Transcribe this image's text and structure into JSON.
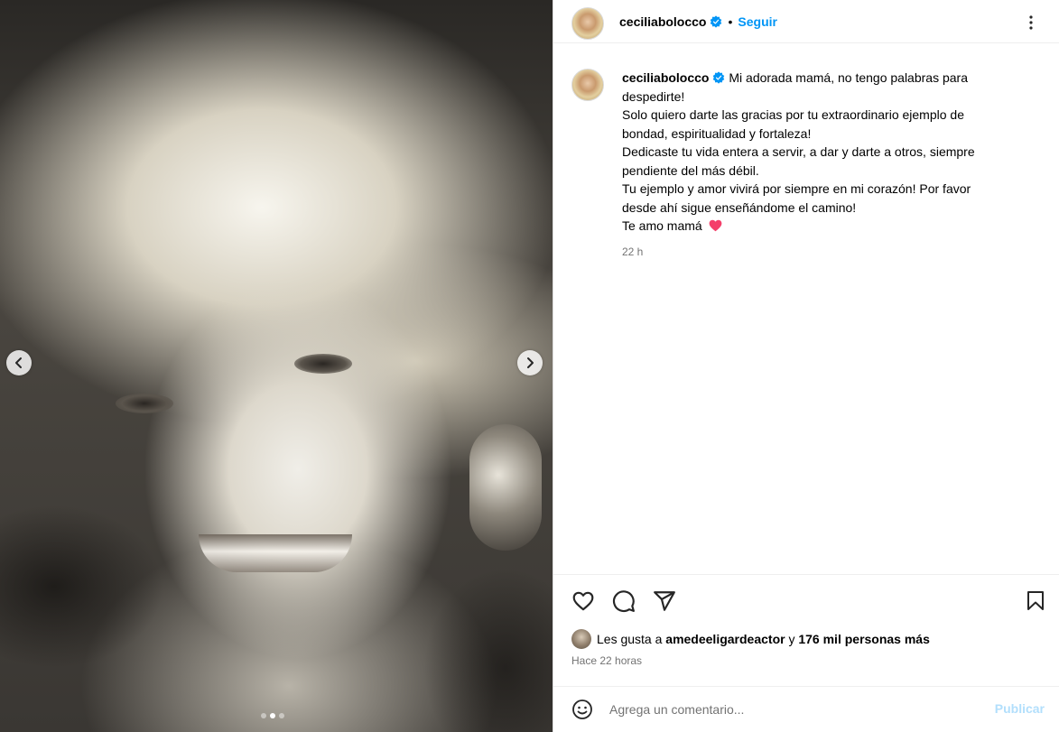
{
  "post": {
    "author": "ceciliabolocco",
    "follow_label": "Seguir",
    "separator": "•",
    "caption_lines": [
      "Mi adorada mamá, no tengo palabras para",
      "despedirte!",
      "Solo quiero darte las gracias por tu extraordinario ejemplo de",
      "bondad, espiritualidad y fortaleza!",
      "Dedicaste tu vida entera a servir, a dar y darte a otros, siempre",
      "pendiente del más débil.",
      "Tu ejemplo y amor vivirá por siempre en mi corazón! Por favor",
      "desde ahí sigue enseñándome el camino!",
      "Te amo mamá"
    ],
    "caption_time": "22 h"
  },
  "likes": {
    "prefix": "Les gusta a",
    "liker": "amedeeligardeactor",
    "conjunction": "y",
    "others": "176 mil personas más"
  },
  "posted_time": "Hace 22 horas",
  "comment": {
    "placeholder": "Agrega un comentario...",
    "publish_label": "Publicar"
  },
  "carousel": {
    "total": 3,
    "active_index": 1
  },
  "colors": {
    "accent": "#0095f6",
    "verified": "#0095f6",
    "publish_disabled": "#b2dffc",
    "heart_emoji": "#f43f6a",
    "secondary_text": "#737373"
  },
  "icons": [
    "chevron-left-icon",
    "chevron-right-icon",
    "verified-badge-icon",
    "more-options-icon",
    "heart-icon",
    "comment-icon",
    "share-icon",
    "bookmark-icon",
    "emoji-icon",
    "heart-emoji-icon"
  ]
}
